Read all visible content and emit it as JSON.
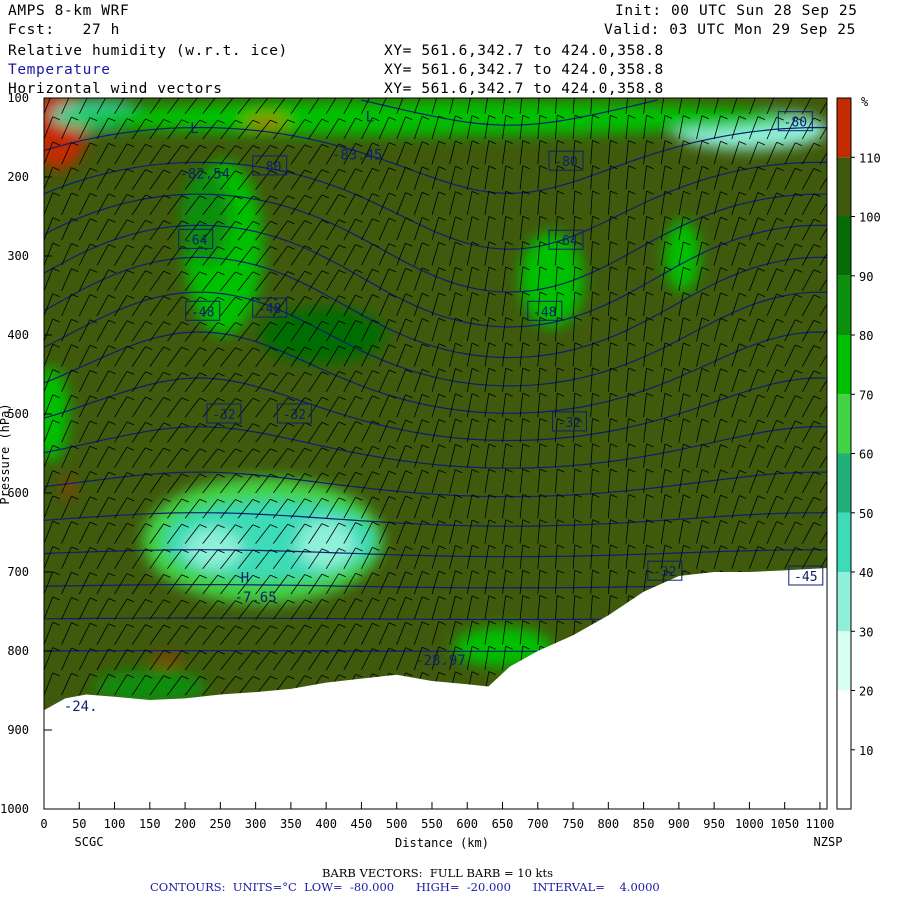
{
  "header": {
    "model": "AMPS 8-km WRF",
    "forecast": "Fcst:   27 h",
    "init": "Init: 00 UTC Sun 28 Sep 25",
    "valid": "Valid: 03 UTC Mon 29 Sep 25",
    "fields": [
      {
        "name": "Relative humidity (w.r.t. ice)",
        "xy": "XY= 561.6,342.7 to 424.0,358.8"
      },
      {
        "name": "Temperature",
        "xy": "XY= 561.6,342.7 to 424.0,358.8"
      },
      {
        "name": "Horizontal wind vectors",
        "xy": "XY= 561.6,342.7 to 424.0,358.8"
      }
    ]
  },
  "footer": {
    "barb": "BARB VECTORS:  FULL BARB = 10 kts",
    "contours": "CONTOURS:  UNITS=°C  LOW=  -80.000      HIGH=  -20.000      INTERVAL=    4.0000"
  },
  "colors": {
    "terrain": "#ffffff",
    "contour": "#0b1f74",
    "barb": "#000000",
    "rh_bins": [
      "#ffffff",
      "#ffffff",
      "#ffffff",
      "#d8fff0",
      "#8ff0d9",
      "#3ddbb8",
      "#22b07a",
      "#43d243",
      "#00c100",
      "#0c8f0c",
      "#066d06",
      "#3f5a0c",
      "#c42b00"
    ]
  },
  "chart_data": {
    "type": "heatmap",
    "xlabel": "Distance (km)",
    "ylabel": "Pressure (hPa)",
    "xlim": [
      0,
      1110
    ],
    "ylim": [
      1000,
      100
    ],
    "xticks": [
      0,
      50,
      100,
      150,
      200,
      250,
      300,
      350,
      400,
      450,
      500,
      550,
      600,
      650,
      700,
      750,
      800,
      850,
      900,
      950,
      1000,
      1050,
      1100
    ],
    "yticks": [
      100,
      200,
      300,
      400,
      500,
      600,
      700,
      800,
      900,
      1000
    ],
    "endpoints": {
      "left": "SCGC",
      "right": "NZSP"
    },
    "colorbar": {
      "unit": "%",
      "levels": [
        10,
        20,
        30,
        40,
        50,
        60,
        70,
        80,
        90,
        100,
        110
      ],
      "colors": [
        "#ffffff",
        "#ffffff",
        "#ffffff",
        "#d8fff0",
        "#8ff0d9",
        "#3ddbb8",
        "#22b07a",
        "#43d243",
        "#00c100",
        "#0c8f0c",
        "#066d06",
        "#3f5a0c",
        "#c42b00"
      ]
    },
    "background_rh": 105,
    "surface": [
      {
        "x": 0,
        "p": 875
      },
      {
        "x": 30,
        "p": 860
      },
      {
        "x": 60,
        "p": 855
      },
      {
        "x": 100,
        "p": 858
      },
      {
        "x": 150,
        "p": 862
      },
      {
        "x": 200,
        "p": 860
      },
      {
        "x": 250,
        "p": 855
      },
      {
        "x": 300,
        "p": 852
      },
      {
        "x": 350,
        "p": 848
      },
      {
        "x": 400,
        "p": 840
      },
      {
        "x": 450,
        "p": 835
      },
      {
        "x": 500,
        "p": 830
      },
      {
        "x": 550,
        "p": 838
      },
      {
        "x": 600,
        "p": 842
      },
      {
        "x": 630,
        "p": 845
      },
      {
        "x": 660,
        "p": 820
      },
      {
        "x": 700,
        "p": 800
      },
      {
        "x": 750,
        "p": 780
      },
      {
        "x": 800,
        "p": 755
      },
      {
        "x": 850,
        "p": 725
      },
      {
        "x": 900,
        "p": 705
      },
      {
        "x": 950,
        "p": 700
      },
      {
        "x": 1000,
        "p": 700
      },
      {
        "x": 1050,
        "p": 698
      },
      {
        "x": 1110,
        "p": 695
      }
    ],
    "rh_regions": [
      {
        "rh": 115,
        "cx": 20,
        "cp": 140,
        "rx": 40,
        "rp": 50
      },
      {
        "rh": 35,
        "cx": 1000,
        "cp": 140,
        "rx": 110,
        "rp": 25
      },
      {
        "rh": 45,
        "cx": 80,
        "cp": 122,
        "rx": 70,
        "rp": 18
      },
      {
        "rh": 75,
        "cx": 540,
        "cp": 125,
        "rx": 520,
        "rp": 22
      },
      {
        "rh": 75,
        "cx": 255,
        "cp": 290,
        "rx": 55,
        "rp": 110
      },
      {
        "rh": 85,
        "cx": 230,
        "cp": 250,
        "rx": 35,
        "rp": 60
      },
      {
        "rh": 75,
        "cx": 720,
        "cp": 330,
        "rx": 45,
        "rp": 60
      },
      {
        "rh": 75,
        "cx": 905,
        "cp": 300,
        "rx": 25,
        "rp": 45
      },
      {
        "rh": 75,
        "cx": 10,
        "cp": 500,
        "rx": 25,
        "rp": 60
      },
      {
        "rh": 95,
        "cx": 395,
        "cp": 400,
        "rx": 90,
        "rp": 35
      },
      {
        "rh": 65,
        "cx": 310,
        "cp": 660,
        "rx": 170,
        "rp": 80
      },
      {
        "rh": 45,
        "cx": 320,
        "cp": 660,
        "rx": 150,
        "rp": 50
      },
      {
        "rh": 35,
        "cx": 400,
        "cp": 665,
        "rx": 40,
        "rp": 30
      },
      {
        "rh": 35,
        "cx": 240,
        "cp": 670,
        "rx": 40,
        "rp": 25
      },
      {
        "rh": 75,
        "cx": 650,
        "cp": 795,
        "rx": 70,
        "rp": 25
      },
      {
        "rh": 85,
        "cx": 150,
        "cp": 845,
        "rx": 80,
        "rp": 20
      },
      {
        "rh": 115,
        "cx": 35,
        "cp": 593,
        "rx": 5,
        "rp": 15
      },
      {
        "rh": 115,
        "cx": 315,
        "cp": 130,
        "rx": 30,
        "rp": 5
      },
      {
        "rh": 115,
        "cx": 175,
        "cp": 810,
        "rx": 20,
        "rp": 4
      }
    ],
    "temperature_contours": [
      {
        "level": -80,
        "label": "-80",
        "lx": 320,
        "lp": 186
      },
      {
        "level": -80,
        "label": "-80",
        "lx": 740,
        "lp": 180
      },
      {
        "level": -80,
        "label": "-80",
        "lx": 1065,
        "lp": 130
      },
      {
        "level": -64,
        "label": "-64",
        "lx": 215,
        "lp": 279
      },
      {
        "level": -64,
        "label": "-64",
        "lx": 740,
        "lp": 280
      },
      {
        "level": -48,
        "label": "-48",
        "lx": 225,
        "lp": 370
      },
      {
        "level": -48,
        "label": "-48",
        "lx": 320,
        "lp": 366
      },
      {
        "level": -48,
        "label": "-48",
        "lx": 710,
        "lp": 370
      },
      {
        "level": -32,
        "label": "-32",
        "lx": 255,
        "lp": 500
      },
      {
        "level": -32,
        "label": "-32",
        "lx": 355,
        "lp": 500
      },
      {
        "level": -32,
        "label": "-32",
        "lx": 745,
        "lp": 510
      },
      {
        "level": -32,
        "label": "-32",
        "lx": 880,
        "lp": 699
      },
      {
        "level": -45,
        "label": "-45",
        "lx": 1080,
        "lp": 705
      }
    ],
    "extrema": [
      {
        "type": "L",
        "label": "L",
        "x": 213,
        "p": 144
      },
      {
        "type": "L",
        "label": "L",
        "x": 462,
        "p": 130
      },
      {
        "type": "value",
        "label": "-82.54",
        "x": 228,
        "p": 202
      },
      {
        "type": "value",
        "label": "-83.45",
        "x": 444,
        "p": 178
      },
      {
        "type": "H",
        "label": "H",
        "x": 285,
        "p": 713
      },
      {
        "type": "value",
        "label": "-7.65",
        "x": 300,
        "p": 738
      },
      {
        "type": "value",
        "label": "-28.97",
        "x": 562,
        "p": 818
      },
      {
        "type": "value",
        "label": "-24.",
        "x": 52,
        "p": 876
      }
    ]
  }
}
